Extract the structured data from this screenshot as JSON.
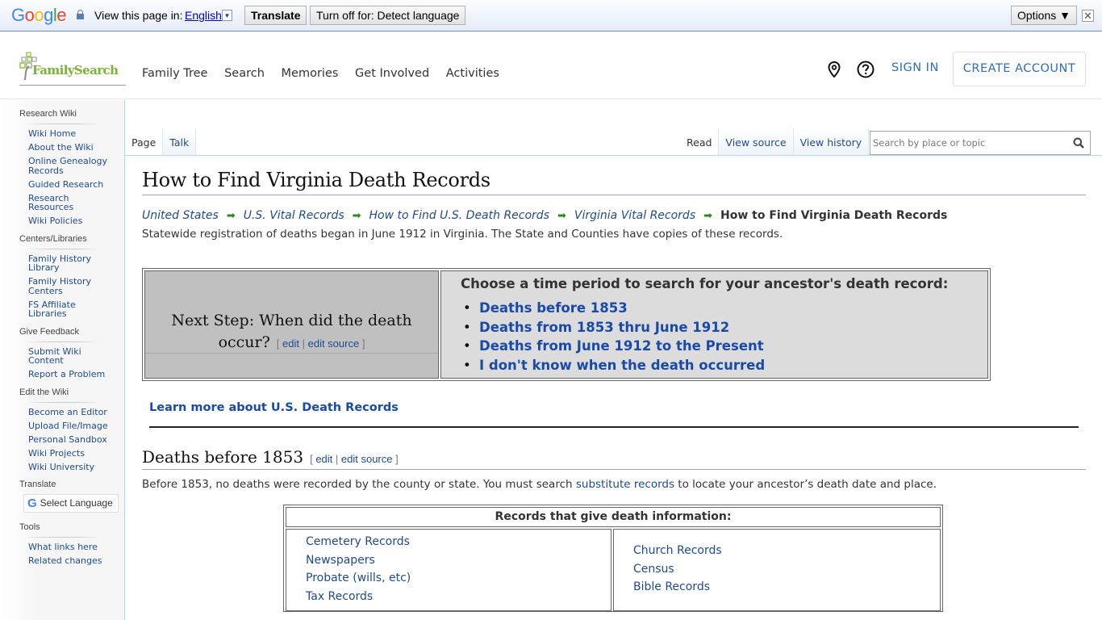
{
  "translate_bar": {
    "brand": [
      "G",
      "o",
      "o",
      "g",
      "l",
      "e"
    ],
    "prompt": "View this page in:",
    "language": "English",
    "translate_button": "Translate",
    "turn_off_button": "Turn off for: Detect language",
    "options_button": "Options ▼",
    "close": "✕"
  },
  "header": {
    "logo_text": "FamilySearch",
    "nav": [
      "Family Tree",
      "Search",
      "Memories",
      "Get Involved",
      "Activities"
    ],
    "sign_in": "SIGN IN",
    "create_account": "CREATE ACCOUNT",
    "icons": [
      "location-pin-icon",
      "help-icon"
    ]
  },
  "sidebar": {
    "sections": [
      {
        "title": "Research Wiki",
        "items": [
          "Wiki Home",
          "About the Wiki",
          "Online Genealogy Records",
          "Guided Research",
          "Research Resources",
          "Wiki Policies"
        ]
      },
      {
        "title": "Centers/Libraries",
        "items": [
          "Family History Library",
          "Family History Centers",
          "FS Affiliate Libraries"
        ]
      },
      {
        "title": "Give Feedback",
        "items": [
          "Submit Wiki Content",
          "Report a Problem"
        ]
      },
      {
        "title": "Edit the Wiki",
        "items": [
          "Become an Editor",
          "Upload File/Image",
          "Personal Sandbox",
          "Wiki Projects",
          "Wiki University"
        ]
      },
      {
        "title": "Translate",
        "select_language": "Select Language"
      },
      {
        "title": "Tools",
        "items": [
          "What links here",
          "Related changes"
        ]
      }
    ]
  },
  "tabs": {
    "left": [
      {
        "label": "Page",
        "selected": true
      },
      {
        "label": "Talk",
        "selected": false
      }
    ],
    "right": [
      {
        "label": "Read",
        "selected": true
      },
      {
        "label": "View source",
        "selected": false
      },
      {
        "label": "View history",
        "selected": false
      }
    ],
    "search_placeholder": "Search by place or topic"
  },
  "page": {
    "title": "How to Find Virginia Death Records",
    "breadcrumbs": [
      "United States",
      "U.S. Vital Records",
      "How to Find U.S. Death Records",
      "Virginia Vital Records"
    ],
    "breadcrumb_current": "How to Find Virginia Death Records",
    "intro": "Statewide registration of deaths began in June 1912 in Virginia. The State and Counties have copies of these records.",
    "next_step": {
      "question": "Next Step: When did the death occur?",
      "edit": "edit",
      "edit_source": "edit source",
      "choose_heading": "Choose a time period to search for your ancestor's death record:",
      "options": [
        "Deaths before 1853",
        "Deaths from 1853 thru June 1912",
        "Deaths from June 1912 to the Present",
        "I don't know when the death occurred"
      ]
    },
    "learn_more": "Learn more about U.S. Death Records",
    "section": {
      "heading": "Deaths before 1853",
      "edit": "edit",
      "edit_source": "edit source",
      "text_before": "Before 1853, no deaths were recorded by the county or state. You must search ",
      "link": "substitute records",
      "text_after": " to locate your ancestor’s death date and place."
    },
    "records_table": {
      "header": "Records that give death information:",
      "col1": [
        "Cemetery Records",
        "Newspapers",
        "Probate (wills, etc)",
        "Tax Records"
      ],
      "col2": [
        "Church Records",
        "Census",
        "Bible Records"
      ]
    }
  }
}
